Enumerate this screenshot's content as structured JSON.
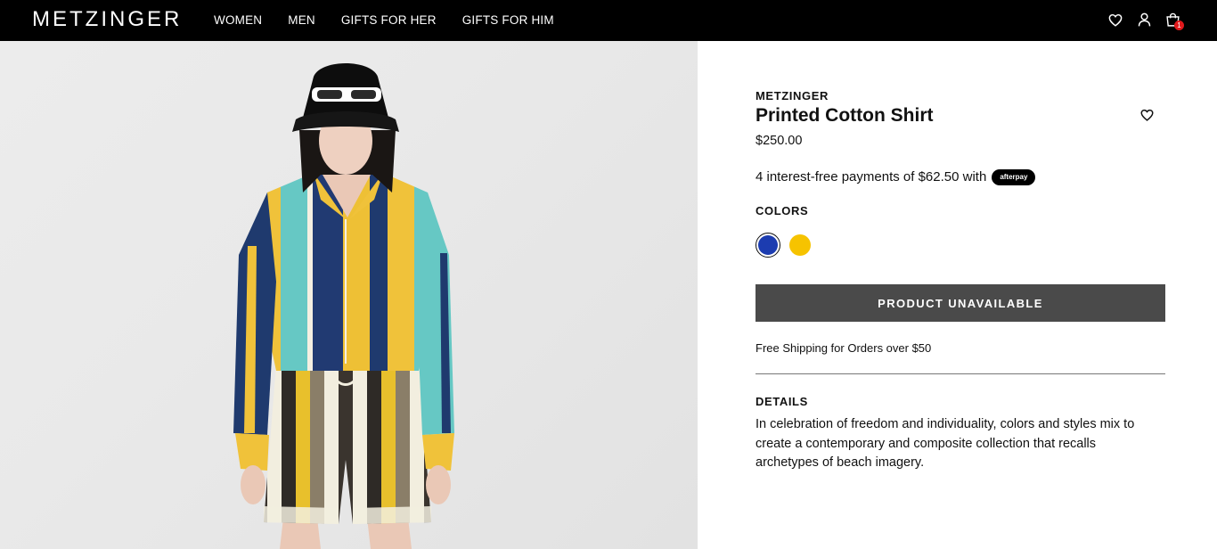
{
  "header": {
    "brand": "METZINGER",
    "nav": [
      "WOMEN",
      "MEN",
      "GIFTS FOR HER",
      "GIFTS FOR HIM"
    ],
    "cart_count": "1",
    "icons": [
      "heart-icon",
      "user-icon",
      "cart-icon"
    ]
  },
  "product": {
    "brand": "METZINGER",
    "title": "Printed Cotton Shirt",
    "price": "$250.00",
    "afterpay_text": "4 interest-free payments of $62.50 with",
    "afterpay_badge": "afterpay",
    "colors_label": "COLORS",
    "colors": [
      {
        "hex": "#1c3cb0",
        "selected": true
      },
      {
        "hex": "#f6c300",
        "selected": false
      }
    ],
    "button_label": "PRODUCT UNAVAILABLE",
    "shipping_text": "Free Shipping for Orders over $50",
    "details_label": "DETAILS",
    "details_text": "In celebration of freedom and individuality, colors and styles mix to create a contemporary and composite collection that recalls archetypes of beach imagery."
  },
  "colors": {
    "topbar": "#000000",
    "button_bg": "#4a4a4a",
    "badge": "#e0191c"
  }
}
